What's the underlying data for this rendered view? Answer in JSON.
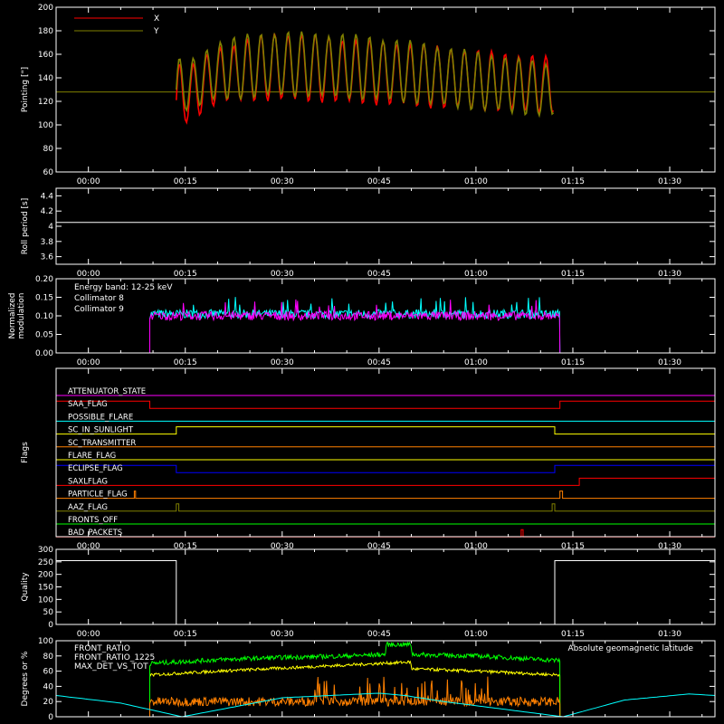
{
  "chart_data": [
    {
      "id": "pointing",
      "type": "line",
      "ylabel": "Pointing [\"]",
      "ylim": [
        60,
        200
      ],
      "yticks": [
        60,
        80,
        100,
        120,
        140,
        160,
        180,
        200
      ],
      "xlim_minutes": [
        -5,
        97
      ],
      "xticks": [
        "00:00",
        "00:15",
        "00:30",
        "00:45",
        "01:00",
        "01:15",
        "01:30"
      ],
      "reference_line": {
        "y": 128,
        "color": "#808000"
      },
      "series": [
        {
          "name": "X",
          "color": "#ff0000",
          "start_minute": 13.6,
          "end_minute": 72.2,
          "upper": {
            "minute": [
              13.6,
              15,
              20,
              25,
              30,
              40,
              50,
              60,
              72.2
            ],
            "value": [
              160,
              148,
              166,
              174,
              180,
              174,
              170,
              164,
              158
            ]
          },
          "lower": {
            "minute": [
              13.6,
              15,
              20,
              25,
              30,
              40,
              50,
              60,
              72.2
            ],
            "value": [
              82,
              100,
              118,
              120,
              120,
              118,
              115,
              112,
              110
            ]
          }
        },
        {
          "name": "Y",
          "color": "#808000",
          "start_minute": 13.6,
          "end_minute": 72.2,
          "upper": {
            "minute": [
              13.6,
              15,
              20,
              25,
              30,
              40,
              50,
              60,
              72.2
            ],
            "value": [
              160,
              152,
              172,
              178,
              180,
              178,
              172,
              163,
              152
            ]
          },
          "lower": {
            "minute": [
              13.6,
              15,
              20,
              25,
              30,
              40,
              50,
              60,
              72.2
            ],
            "value": [
              100,
              112,
              120,
              122,
              124,
              122,
              118,
              112,
              106
            ]
          }
        }
      ]
    },
    {
      "id": "roll",
      "type": "line",
      "ylabel": "Roll period [s]",
      "ylim": [
        3.5,
        4.5
      ],
      "yticks": [
        3.6,
        3.8,
        4.0,
        4.2,
        4.4
      ],
      "xticks": [
        "00:00",
        "00:15",
        "00:30",
        "00:45",
        "01:00",
        "01:15",
        "01:30"
      ],
      "series": [
        {
          "color": "#ffffff",
          "minute": [
            -5,
            97
          ],
          "value": [
            4.05,
            4.05
          ]
        }
      ]
    },
    {
      "id": "modulation",
      "type": "line",
      "ylabel": [
        "Normalized",
        "modulation"
      ],
      "ylim": [
        0,
        0.2
      ],
      "yticks": [
        "0.00",
        "0.05",
        "0.10",
        "0.15",
        "0.20"
      ],
      "annotation": "Energy band: 12-25 keV",
      "xticks": [
        "00:00",
        "00:15",
        "00:30",
        "00:45",
        "01:00",
        "01:15",
        "01:30"
      ],
      "series": [
        {
          "name": "Collimator 8",
          "color": "#00ffff",
          "start_minute": 9.5,
          "end_minute": 73,
          "mean": 0.105,
          "spread": 0.012
        },
        {
          "name": "Collimator 9",
          "color": "#ff00ff",
          "start_minute": 9.5,
          "end_minute": 73,
          "mean": 0.1,
          "spread": 0.012
        }
      ]
    },
    {
      "id": "flags",
      "type": "line",
      "ylabel": "Flags",
      "xticks": [
        "00:00",
        "00:15",
        "00:30",
        "00:45",
        "01:00",
        "01:15",
        "01:30"
      ],
      "flags": [
        {
          "name": "ATTENUATOR_STATE",
          "color": "#ff00ff",
          "on": []
        },
        {
          "name": "SAA_FLAG",
          "color": "#ff0000",
          "on": [
            [
              -5,
              9.5
            ],
            [
              73,
              97
            ]
          ]
        },
        {
          "name": "POSSIBLE_FLARE",
          "color": "#00ffff",
          "on": []
        },
        {
          "name": "SC_IN_SUNLIGHT",
          "color": "#ffff00",
          "on": [
            [
              13.6,
              72.2
            ]
          ]
        },
        {
          "name": "SC_TRANSMITTER",
          "color": "#ff8000",
          "on": []
        },
        {
          "name": "FLARE_FLAG",
          "color": "#ffff00",
          "on": []
        },
        {
          "name": "ECLIPSE_FLAG",
          "color": "#0000ff",
          "on": [
            [
              -5,
              13.6
            ],
            [
              72.2,
              97
            ]
          ]
        },
        {
          "name": "SAXLFLAG",
          "color": "#ff0000",
          "on": [
            [
              76,
              97
            ]
          ]
        },
        {
          "name": "PARTICLE_FLAG",
          "color": "#ff8000",
          "on": [
            [
              7.1,
              7.3
            ],
            [
              73,
              73.4
            ]
          ]
        },
        {
          "name": "AAZ_FLAG",
          "color": "#808000",
          "on": [
            [
              13.6,
              14
            ],
            [
              71.8,
              72.2
            ]
          ]
        },
        {
          "name": "FRONTS_OFF",
          "color": "#00ff00",
          "on": []
        },
        {
          "name": "BAD_PACKETS",
          "color": "#ff0000",
          "on": [
            [
              67,
              67.3
            ]
          ]
        }
      ]
    },
    {
      "id": "quality",
      "type": "line",
      "ylabel": "Quality",
      "ylim": [
        0,
        300
      ],
      "yticks": [
        0,
        50,
        100,
        150,
        200,
        250,
        300
      ],
      "xticks": [
        "00:00",
        "00:15",
        "00:30",
        "00:45",
        "01:00",
        "01:15",
        "01:30"
      ],
      "series": [
        {
          "color": "#ffffff",
          "minute": [
            -5,
            13.6,
            13.6,
            72.2,
            72.2,
            97
          ],
          "value": [
            255,
            255,
            0,
            0,
            255,
            255
          ]
        }
      ]
    },
    {
      "id": "geo",
      "type": "line",
      "ylabel": "Degrees or %",
      "ylim": [
        0,
        100
      ],
      "yticks": [
        0,
        20,
        40,
        60,
        80,
        100
      ],
      "annotation": "Absolute geomagnetic latitude",
      "series": [
        {
          "name": "FRONT_RATIO",
          "color": "#ffff00",
          "start_minute": 9.5,
          "end_minute": 73,
          "minute": [
            9.5,
            20,
            30,
            40,
            49.9,
            50,
            60,
            73
          ],
          "value": [
            55,
            60,
            64,
            68,
            72,
            63,
            60,
            55
          ],
          "noise": 2
        },
        {
          "name": "FRONT_RATIO_1225",
          "color": "#00ff00",
          "start_minute": 9.5,
          "end_minute": 73,
          "minute": [
            9.5,
            20,
            30,
            40,
            46,
            46.1,
            50,
            50.1,
            60,
            73
          ],
          "value": [
            70,
            75,
            78,
            80,
            82,
            95,
            95,
            82,
            80,
            74
          ],
          "noise": 3
        },
        {
          "name": "MAX_DET_VS_TOT",
          "color": "#ff8000",
          "start_minute": 9.5,
          "end_minute": 73,
          "minute": [
            9.5,
            73
          ],
          "value": [
            20,
            20
          ],
          "noise": 6,
          "bursts": [
            [
              35,
              62
            ]
          ]
        },
        {
          "name": "Absolute geomagnetic latitude",
          "color": "#00ffff",
          "minute": [
            -5,
            5,
            14.5,
            30,
            45,
            49,
            55,
            73.5,
            83,
            93,
            97
          ],
          "value": [
            28,
            18,
            0,
            25,
            31,
            28,
            20,
            0,
            22,
            30,
            28
          ]
        }
      ]
    }
  ]
}
